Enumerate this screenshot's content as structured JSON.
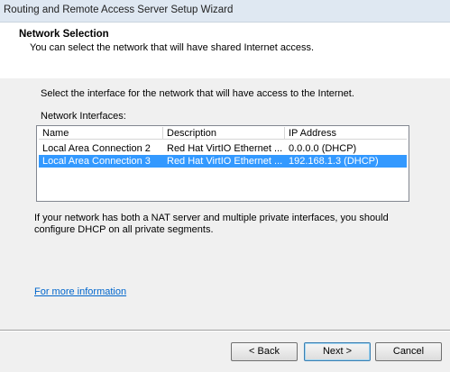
{
  "window": {
    "title": "Routing and Remote Access Server Setup Wizard"
  },
  "header": {
    "title": "Network Selection",
    "subtitle": "You can select the network that will have shared Internet access."
  },
  "body": {
    "intro": "Select the interface for the network that will have access to the Internet.",
    "interfaces_label": "Network Interfaces:",
    "columns": [
      "Name",
      "Description",
      "IP Address"
    ],
    "rows": [
      {
        "name": "Local Area Connection 2",
        "description": "Red Hat VirtIO Ethernet ...",
        "ip": "0.0.0.0 (DHCP)",
        "selected": false
      },
      {
        "name": "Local Area Connection 3",
        "description": "Red Hat VirtIO Ethernet ...",
        "ip": "192.168.1.3 (DHCP)",
        "selected": true
      }
    ],
    "info": "If your network has both a NAT server and multiple private interfaces, you should configure DHCP on all private segments.",
    "more_info_link": "For more information"
  },
  "buttons": {
    "back": "< Back",
    "next": "Next >",
    "cancel": "Cancel"
  },
  "colors": {
    "selection": "#3399ff",
    "link": "#0066cc"
  }
}
